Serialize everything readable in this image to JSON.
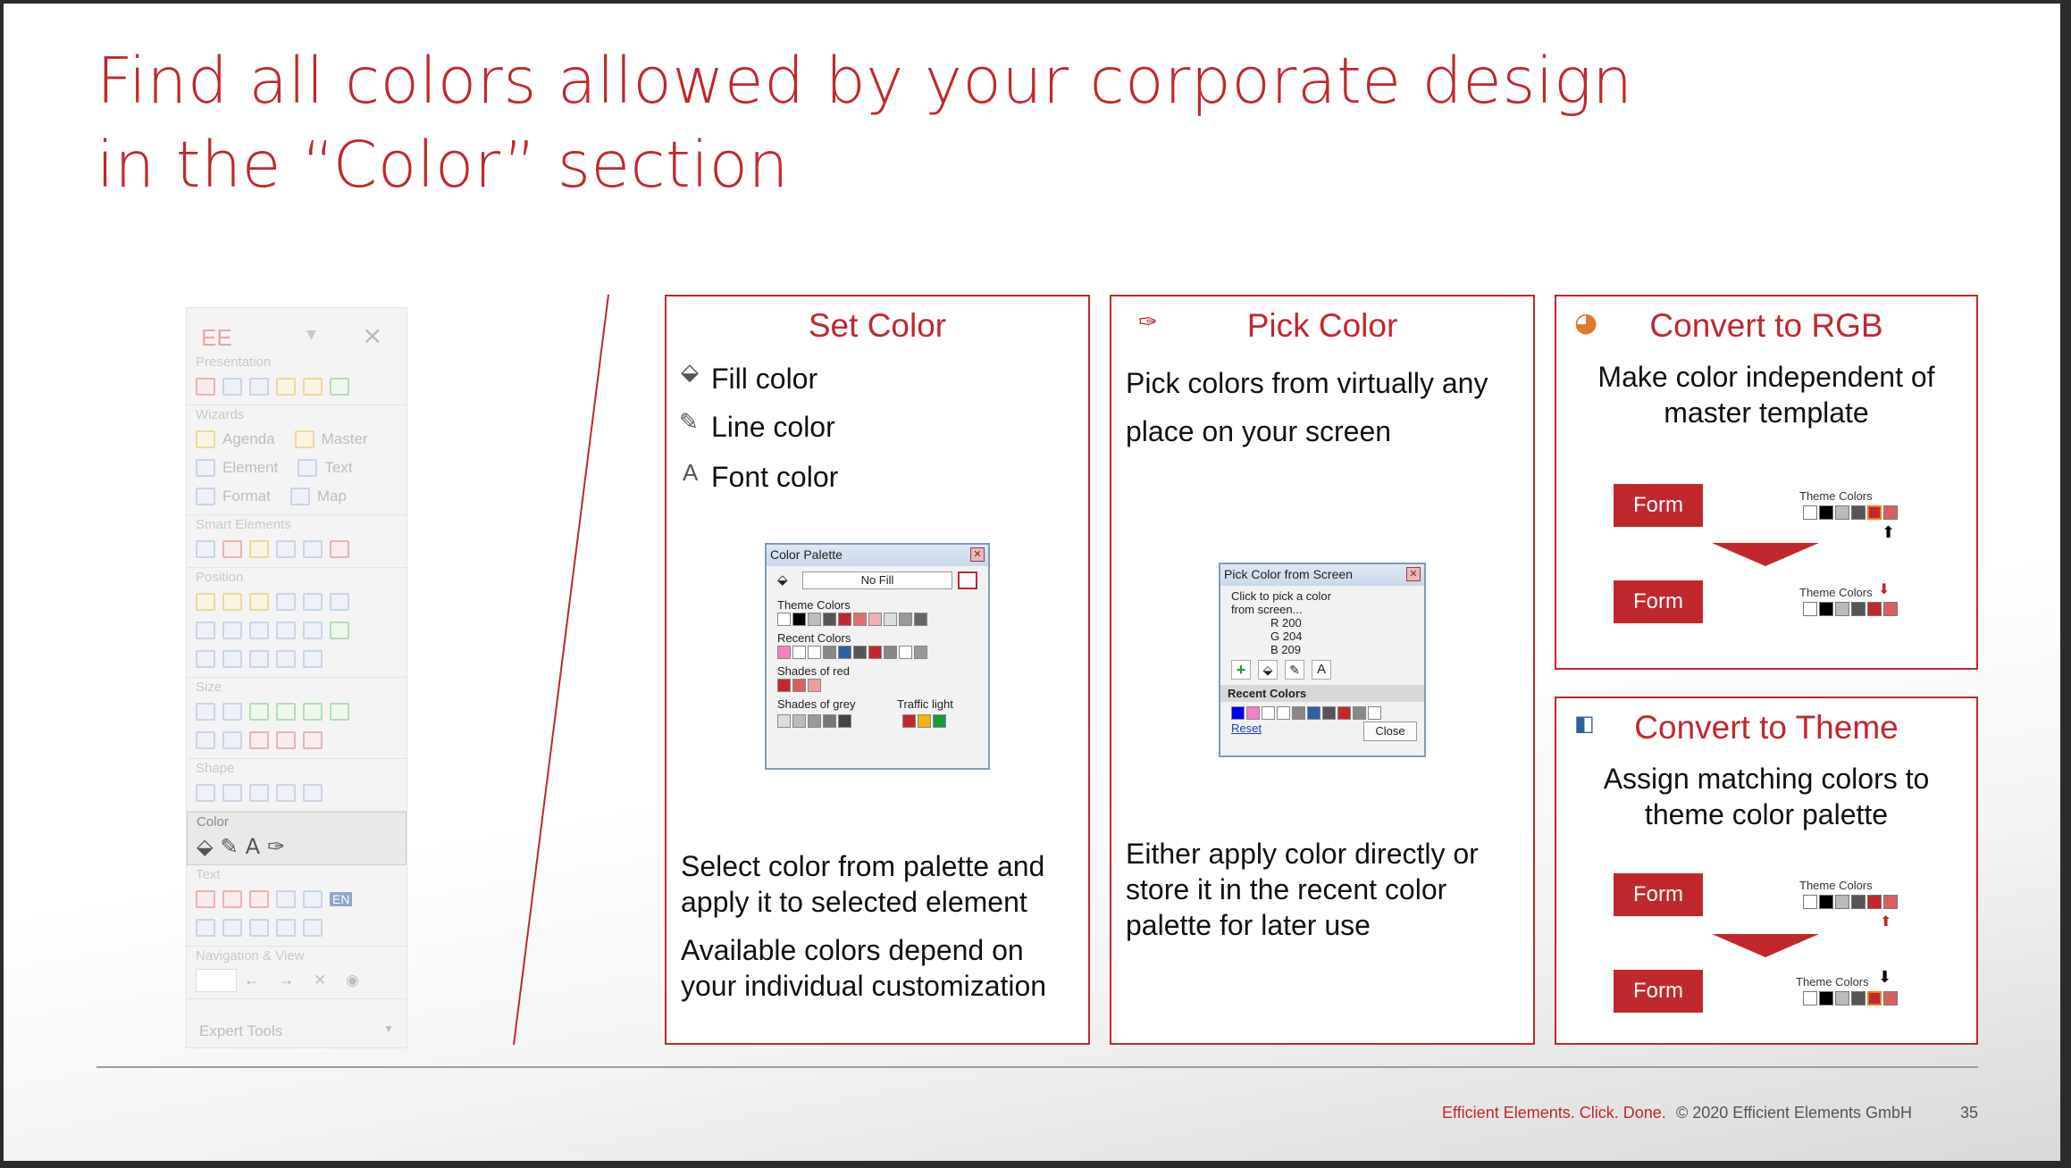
{
  "slide": {
    "title_line1": "Find all colors allowed by your corporate design",
    "title_line2": "in the “Color” section"
  },
  "ribbon": {
    "logo": "EE",
    "sections": {
      "presentation": "Presentation",
      "wizards": "Wizards",
      "smart_elements": "Smart Elements",
      "position": "Position",
      "size": "Size",
      "shape": "Shape",
      "color": "Color",
      "text": "Text",
      "navigation": "Navigation & View"
    },
    "items": {
      "agenda": "Agenda",
      "master": "Master",
      "element": "Element",
      "text": "Text",
      "format": "Format",
      "map": "Map",
      "lang_en": "EN"
    },
    "expert_tools": "Expert Tools"
  },
  "set_color": {
    "title": "Set Color",
    "fill": "Fill color",
    "line": "Line color",
    "font": "Font color",
    "desc1_line1": "Select color from palette and",
    "desc1_line2": "apply it to selected element",
    "desc2_line1": "Available colors depend on",
    "desc2_line2": "your individual customization",
    "dialog": {
      "title": "Color Palette",
      "no_fill": "No Fill",
      "theme": "Theme Colors",
      "recent": "Recent Colors",
      "shades_red": "Shades of red",
      "shades_grey": "Shades of grey",
      "traffic": "Traffic light"
    }
  },
  "pick_color": {
    "title": "Pick Color",
    "desc1_line1": "Pick colors from virtually any",
    "desc1_line2": "place on your screen",
    "desc2_line1": "Either apply color directly or",
    "desc2_line2": "store it in the recent color",
    "desc2_line3": "palette for later use",
    "dialog": {
      "title": "Pick Color from Screen",
      "hint1": "Click to pick a color",
      "hint2": "from screen...",
      "r": "R  200",
      "g": "G  204",
      "b": "B  209",
      "recent": "Recent Colors",
      "reset": "Reset",
      "close": "Close"
    }
  },
  "convert_rgb": {
    "title": "Convert to RGB",
    "desc_line1": "Make color independent of",
    "desc_line2": "master template",
    "form": "Form",
    "theme_colors": "Theme Colors"
  },
  "convert_theme": {
    "title": "Convert to Theme",
    "desc_line1": "Assign matching colors to",
    "desc_line2": "theme color palette",
    "form": "Form",
    "theme_colors": "Theme Colors"
  },
  "footer": {
    "tagline": "Efficient Elements. Click. Done.",
    "copyright": "© 2020 Efficient Elements GmbH",
    "page": "35"
  },
  "colors": {
    "accent": "#c0282d",
    "text": "#111111"
  }
}
